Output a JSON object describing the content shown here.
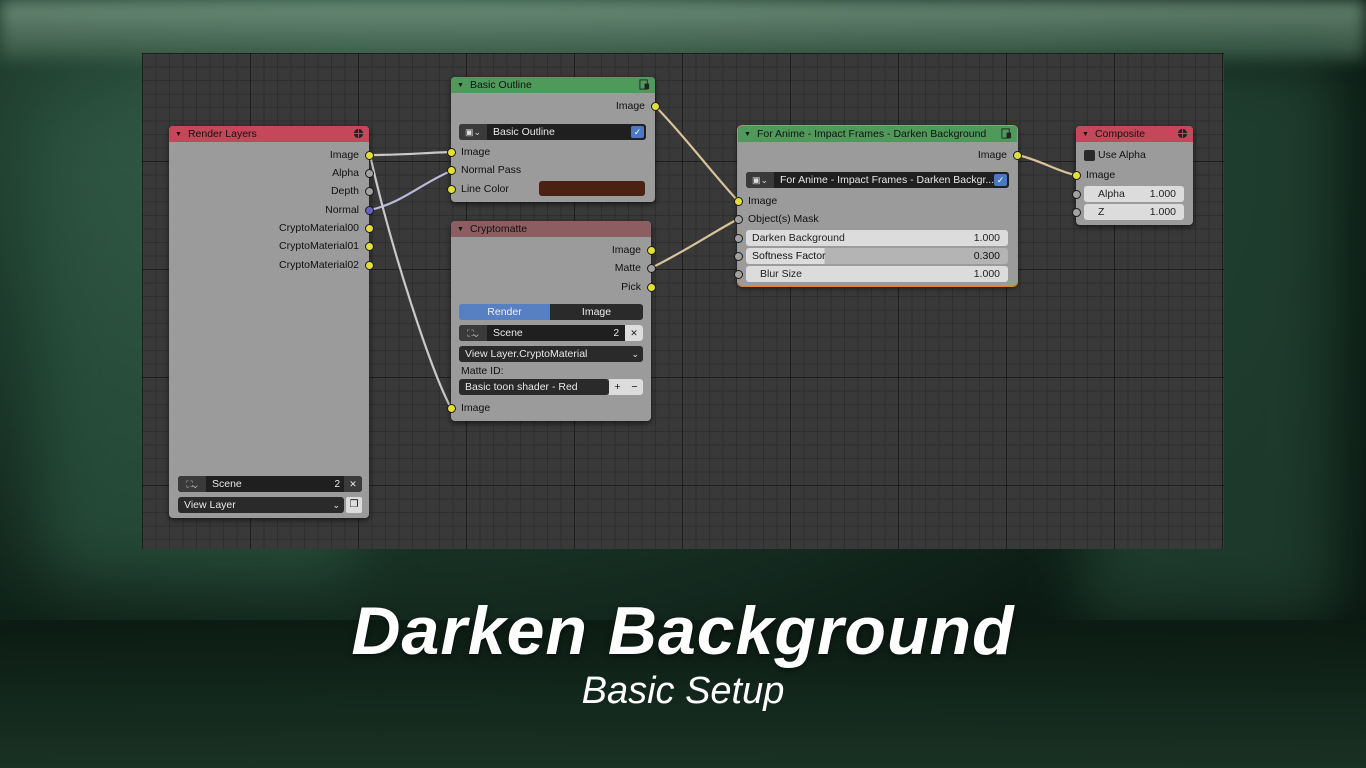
{
  "colors": {
    "editor_bg": "#393939",
    "node_body": "#9b9b9b",
    "header_input": "#c5475a",
    "header_group": "#4f9a5a",
    "header_crypto": "#8c5e61",
    "socket_color": "#e2df39",
    "socket_float": "#a1a1a1",
    "socket_vector": "#6363c7",
    "active_outline": "#e0842e",
    "line_color_value": "#4b2114"
  },
  "render_layers": {
    "title": "Render Layers",
    "outputs": [
      "Image",
      "Alpha",
      "Depth",
      "Normal",
      "CryptoMaterial00",
      "CryptoMaterial01",
      "CryptoMaterial02"
    ],
    "scene": {
      "name": "Scene",
      "users": "2",
      "close": "✕"
    },
    "view_layer": "View Layer"
  },
  "basic_outline": {
    "title": "Basic Outline",
    "output": "Image",
    "group_name": "Basic Outline",
    "inputs": [
      "Image",
      "Normal Pass",
      "Line Color"
    ]
  },
  "cryptomatte": {
    "title": "Cryptomatte",
    "outputs": [
      "Image",
      "Matte",
      "Pick"
    ],
    "tabs": [
      "Render",
      "Image"
    ],
    "scene": {
      "name": "Scene",
      "users": "2",
      "close": "✕"
    },
    "layer": "View Layer.CryptoMaterial",
    "matte_id_label": "Matte ID:",
    "matte_id": "Basic toon shader - Red",
    "add": "+",
    "remove": "−",
    "input": "Image"
  },
  "anime_group": {
    "title": "For Anime - Impact Frames - Darken Background",
    "output": "Image",
    "group_name": "For Anime - Impact Frames - Darken Backgr...",
    "inputs": [
      "Image",
      "Object(s) Mask"
    ],
    "fields": [
      {
        "label": "Darken Background",
        "value": "1.000"
      },
      {
        "label": "Softness Factor",
        "value": "0.300"
      },
      {
        "label": "Blur Size",
        "value": "1.000"
      }
    ]
  },
  "composite": {
    "title": "Composite",
    "use_alpha": "Use Alpha",
    "input": "Image",
    "fields": [
      {
        "label": "Alpha",
        "value": "1.000"
      },
      {
        "label": "Z",
        "value": "1.000"
      }
    ]
  },
  "caption": {
    "title": "Darken Background",
    "subtitle": "Basic Setup"
  }
}
